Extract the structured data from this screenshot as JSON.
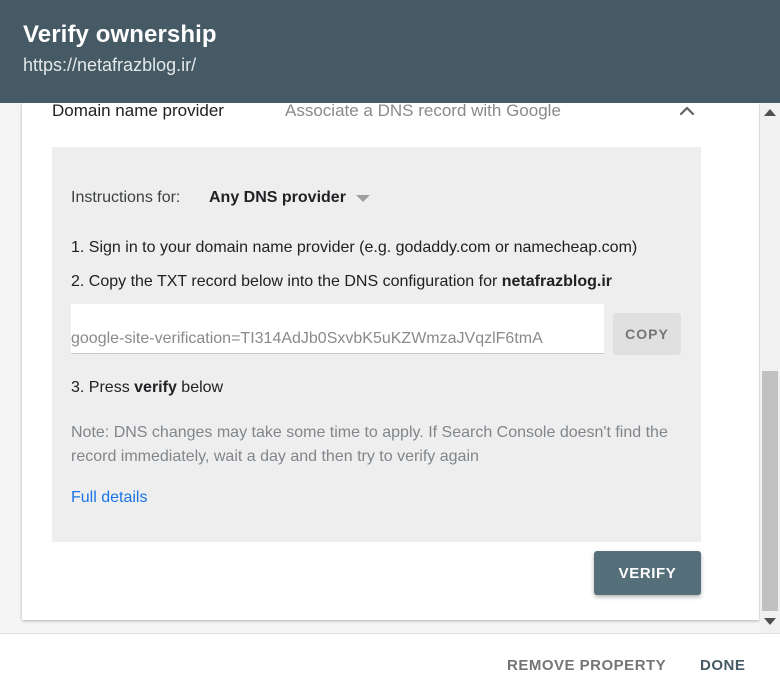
{
  "header": {
    "title": "Verify ownership",
    "subtitle": "https://netafrazblog.ir/",
    "background": "#455a64"
  },
  "method": {
    "label": "Domain name provider",
    "description": "Associate a DNS record with Google",
    "toggle_icon": "chevron-up-icon"
  },
  "instructions": {
    "label": "Instructions for:",
    "selected_provider": "Any DNS provider",
    "dropdown_icon": "caret-down-icon"
  },
  "steps": {
    "step1": "1. Sign in to your domain name provider (e.g. godaddy.com or namecheap.com)",
    "step2_prefix": "2. Copy the TXT record below into the DNS configuration for ",
    "step2_domain": "netafrazblog.ir",
    "step3_prefix": "3. Press ",
    "step3_bold": "verify",
    "step3_suffix": " below"
  },
  "txt_record": {
    "value": "google-site-verification=TI314AdJb0SxvbK5uKZWmzaJVqzlF6tmA"
  },
  "copy_label": "COPY",
  "note": "Note: DNS changes may take some time to apply. If Search Console doesn't find the record immediately, wait a day and then try to verify again",
  "full_details_label": "Full details",
  "verify_label": "VERIFY",
  "footer": {
    "remove_label": "REMOVE PROPERTY",
    "done_label": "DONE"
  },
  "colors": {
    "accent": "#546e7a",
    "link": "#1a73e8"
  }
}
